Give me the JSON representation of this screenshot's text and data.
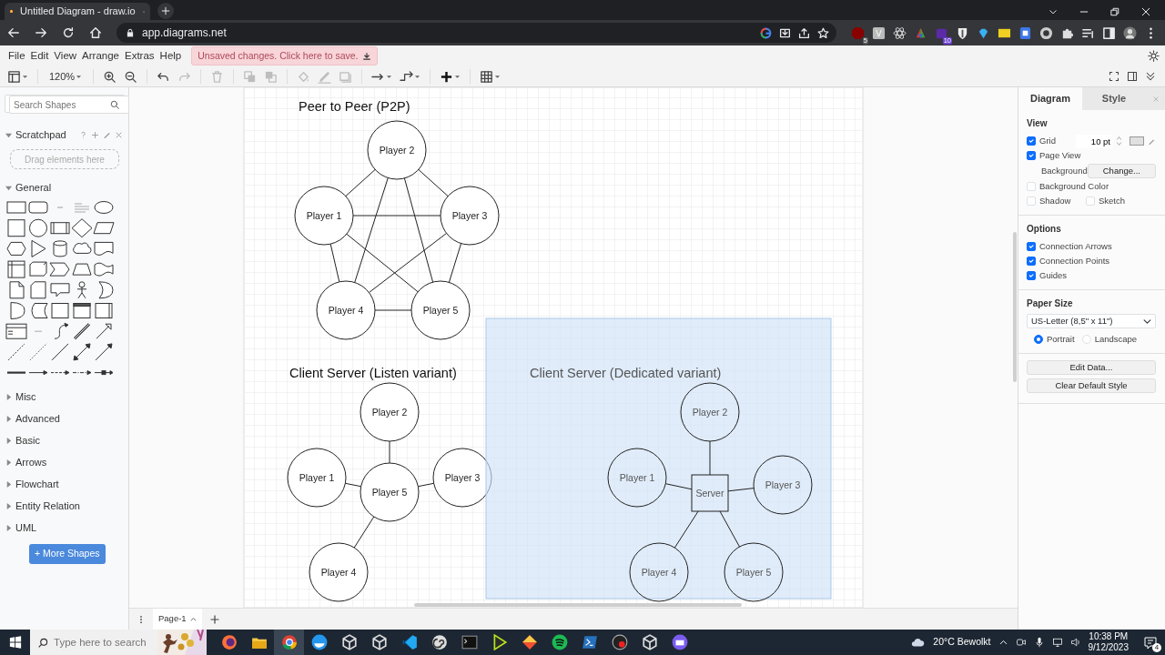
{
  "browser": {
    "tab_title": "Untitled Diagram - draw.io",
    "url": "app.diagrams.net",
    "extension_badges": [
      "5",
      "10"
    ]
  },
  "menu": [
    "File",
    "Edit",
    "View",
    "Arrange",
    "Extras",
    "Help"
  ],
  "unsaved_notice": "Unsaved changes. Click here to save.",
  "toolbar": {
    "zoom": "120%",
    "tools": [
      {
        "kind": "panel",
        "disabled": false
      },
      {
        "kind": "zoom_in",
        "disabled": false
      },
      {
        "kind": "zoom_out",
        "disabled": false
      },
      {
        "kind": "undo",
        "disabled": false
      },
      {
        "kind": "redo",
        "disabled": true
      },
      {
        "kind": "delete",
        "disabled": true
      },
      {
        "kind": "to_front",
        "disabled": true
      },
      {
        "kind": "to_back",
        "disabled": true
      },
      {
        "kind": "fill",
        "disabled": true
      },
      {
        "kind": "line",
        "disabled": true
      },
      {
        "kind": "shadow",
        "disabled": true
      },
      {
        "kind": "connection",
        "disabled": false
      },
      {
        "kind": "waypoints",
        "disabled": false
      },
      {
        "kind": "insert",
        "disabled": false
      },
      {
        "kind": "table",
        "disabled": false
      }
    ]
  },
  "sidebar": {
    "search": {
      "placeholder": "Search Shapes"
    },
    "scratchpad": {
      "title": "Scratchpad",
      "expanded": true,
      "hint": "Drag elements here"
    },
    "libraries": [
      {
        "title": "General",
        "expanded": true
      },
      {
        "title": "Misc",
        "expanded": false
      },
      {
        "title": "Advanced",
        "expanded": false
      },
      {
        "title": "Basic",
        "expanded": false
      },
      {
        "title": "Arrows",
        "expanded": false
      },
      {
        "title": "Flowchart",
        "expanded": false
      },
      {
        "title": "Entity Relation",
        "expanded": false
      },
      {
        "title": "UML",
        "expanded": false
      }
    ],
    "more_button": "+ More Shapes"
  },
  "diagram": {
    "sections": [
      {
        "title": "Peer to Peer (P2P)",
        "kind": "mesh",
        "selected": false,
        "nodes": [
          {
            "label": "Player 2",
            "kind": "circle"
          },
          {
            "label": "Player 1",
            "kind": "circle"
          },
          {
            "label": "Player 3",
            "kind": "circle"
          },
          {
            "label": "Player 4",
            "kind": "circle"
          },
          {
            "label": "Player 5",
            "kind": "circle"
          }
        ]
      },
      {
        "title": "Client Server (Listen variant)",
        "kind": "star",
        "selected": false,
        "hub": {
          "label": "Player 5",
          "kind": "circle"
        },
        "nodes": [
          {
            "label": "Player 2",
            "kind": "circle"
          },
          {
            "label": "Player 1",
            "kind": "circle"
          },
          {
            "label": "Player 3",
            "kind": "circle"
          },
          {
            "label": "Player 4",
            "kind": "circle"
          }
        ]
      },
      {
        "title": "Client Server (Dedicated variant)",
        "kind": "star",
        "selected": true,
        "hub": {
          "label": "Server",
          "kind": "square"
        },
        "nodes": [
          {
            "label": "Player 2",
            "kind": "circle"
          },
          {
            "label": "Player 1",
            "kind": "circle"
          },
          {
            "label": "Player 3",
            "kind": "circle"
          },
          {
            "label": "Player 4",
            "kind": "circle"
          },
          {
            "label": "Player 5",
            "kind": "circle"
          }
        ]
      }
    ]
  },
  "format_panel": {
    "tabs": [
      {
        "label": "Diagram",
        "selected": true
      },
      {
        "label": "Style",
        "selected": false
      }
    ],
    "sections": [
      {
        "title": "View",
        "rows": [
          {
            "kind": "checkbox",
            "label": "Grid",
            "checked": true,
            "value": "10 pt"
          },
          {
            "kind": "checkbox",
            "label": "Page View",
            "checked": true
          },
          {
            "kind": "button",
            "label": "Background",
            "button": "Change..."
          },
          {
            "kind": "checkbox",
            "label": "Background Color",
            "checked": false
          },
          {
            "kind": "checkpair",
            "items": [
              {
                "label": "Shadow",
                "checked": false
              },
              {
                "label": "Sketch",
                "checked": false
              }
            ]
          }
        ]
      },
      {
        "title": "Options",
        "rows": [
          {
            "kind": "checkbox",
            "label": "Connection Arrows",
            "checked": true
          },
          {
            "kind": "checkbox",
            "label": "Connection Points",
            "checked": true
          },
          {
            "kind": "checkbox",
            "label": "Guides",
            "checked": true
          }
        ]
      },
      {
        "title": "Paper Size",
        "rows": [
          {
            "kind": "select",
            "value": "US-Letter (8,5\" x 11\")"
          },
          {
            "kind": "radios",
            "items": [
              {
                "label": "Portrait",
                "selected": true
              },
              {
                "label": "Landscape",
                "selected": false
              }
            ]
          }
        ]
      },
      {
        "rows": [
          {
            "kind": "wide_button",
            "label": "Edit Data..."
          },
          {
            "kind": "wide_button",
            "label": "Clear Default Style"
          }
        ]
      }
    ]
  },
  "pages": [
    {
      "label": "Page-1",
      "selected": true
    }
  ],
  "taskbar": {
    "search": {
      "placeholder": "Type here to search"
    },
    "apps": [
      {
        "kind": "firefox",
        "selected": false
      },
      {
        "kind": "folder",
        "selected": false
      },
      {
        "kind": "chrome",
        "selected": true
      },
      {
        "kind": "whale",
        "selected": false
      },
      {
        "kind": "cube",
        "selected": false
      },
      {
        "kind": "cube",
        "selected": false
      },
      {
        "kind": "code",
        "selected": false
      },
      {
        "kind": "spiral",
        "selected": false
      },
      {
        "kind": "terminal",
        "selected": false
      },
      {
        "kind": "play",
        "selected": false
      },
      {
        "kind": "diamond",
        "selected": false
      },
      {
        "kind": "wave",
        "selected": false
      },
      {
        "kind": "prompt",
        "selected": false
      },
      {
        "kind": "round",
        "selected": false
      },
      {
        "kind": "cube",
        "selected": false
      },
      {
        "kind": "chat",
        "selected": false
      }
    ],
    "weather": "20°C  Bewolkt",
    "time": "10:38 PM",
    "date": "9/12/2023",
    "notifications": "4"
  }
}
